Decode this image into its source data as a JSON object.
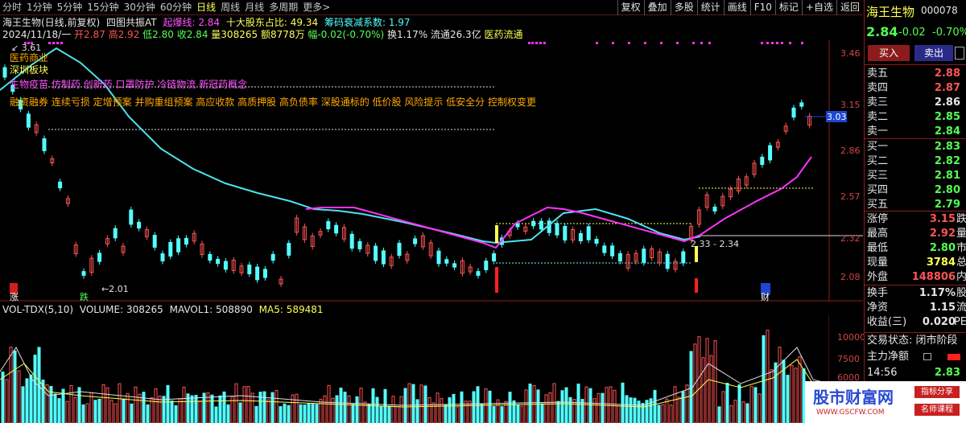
{
  "periods": [
    "分时",
    "1分钟",
    "5分钟",
    "15分钟",
    "30分钟",
    "60分钟",
    "日线",
    "周线",
    "月线",
    "多周期",
    "更多>"
  ],
  "active_period": "日线",
  "toolbar": [
    "复权",
    "叠加",
    "多股",
    "统计",
    "画线",
    "F10",
    "标记",
    "+自选",
    "返回"
  ],
  "header": {
    "title": "海王生物(日线,前复权)",
    "indicator": "四图共振AT",
    "qibao_label": "起爆线:",
    "qibao_value": "2.84",
    "top10_label": "十大股东占比:",
    "top10_value": "49.34",
    "chip_label": "筹码衰减系数:",
    "chip_value": "1.97"
  },
  "quote_line": {
    "date": "2024/11/18/一",
    "open": "开2.87",
    "high": "高2.92",
    "low": "低2.80",
    "close": "收2.84",
    "volume": "量308265",
    "amount": "额8778万",
    "change": "幅-0.02(-0.70%)",
    "turnover": "换1.17%",
    "float": "流通26.3亿",
    "sector": "医药流通"
  },
  "overlay_labels": {
    "line1": "医药商业",
    "line2": "深圳板块",
    "line3": "生物疫苗 仿制药 创新药 口罩防护 冷链物流 新冠药概念",
    "line4": "融资融券 连续亏损 定增预案 并购重组预案 高应收款 高质押股 高负债率 深股通标的 低价股 风险提示 低安全分 控制权变更",
    "price_tag_top": "3.61",
    "price_tag_low": "2.01",
    "range_label": "2.33 - 2.34",
    "zhang": "涨",
    "die": "跌",
    "cai": "财"
  },
  "price_axis": [
    "3.46",
    "3.15",
    "2.86",
    "2.57",
    "2.32",
    "2.08"
  ],
  "current_price_tag": "3.03",
  "volume_header": {
    "name": "VOL-TDX(5,10)",
    "volume": "VOLUME: 308265",
    "mavol1": "MAVOL1: 508890",
    "ma5": "MA5: 589481"
  },
  "volume_axis": [
    "10000",
    "7500",
    "6000"
  ],
  "panel": {
    "stock_name": "海王生物",
    "stock_code": "000078",
    "price": "2.84",
    "change": "-0.02",
    "change_pct": "-0.70%",
    "buy_btn": "买入",
    "sell_btn": "卖出",
    "sells": [
      {
        "label": "卖五",
        "price": "2.88"
      },
      {
        "label": "卖四",
        "price": "2.87"
      },
      {
        "label": "卖三",
        "price": "2.86"
      },
      {
        "label": "卖二",
        "price": "2.85"
      },
      {
        "label": "卖一",
        "price": "2.84"
      }
    ],
    "buys": [
      {
        "label": "买一",
        "price": "2.83"
      },
      {
        "label": "买二",
        "price": "2.82"
      },
      {
        "label": "买三",
        "price": "2.81"
      },
      {
        "label": "买四",
        "price": "2.80"
      },
      {
        "label": "买五",
        "price": "2.79"
      }
    ],
    "stats": [
      {
        "label": "涨停",
        "value": "3.15",
        "suffix": "跌",
        "color": "#ff5454"
      },
      {
        "label": "最高",
        "value": "2.92",
        "suffix": "量",
        "color": "#ff5454"
      },
      {
        "label": "最低",
        "value": "2.80",
        "suffix": "市",
        "color": "#54ff54"
      },
      {
        "label": "现量",
        "value": "3784",
        "suffix": "总",
        "color": "#ffff54"
      },
      {
        "label": "外盘",
        "value": "148806",
        "suffix": "内",
        "color": "#ff5454"
      }
    ],
    "stats2": [
      {
        "label": "换手",
        "value": "1.17%",
        "suffix": "股"
      },
      {
        "label": "净资",
        "value": "1.15",
        "suffix": "流"
      },
      {
        "label": "收益(三)",
        "value": "0.020",
        "suffix": "PE"
      }
    ],
    "trade_status": "交易状态: 闭市阶段",
    "main_flow": "主力净额",
    "tick_time": "14:56",
    "tick_price": "2.83"
  },
  "watermark": {
    "main": "股市财富网",
    "url": "WWW.GSCFW.COM",
    "tag1": "指标分享",
    "tag2": "名师课程"
  },
  "colors": {
    "up": "#ff5454",
    "down": "#54ffff",
    "ma_cyan": "#4ee2ee",
    "ma_magenta": "#ff33ff"
  },
  "chart_data": {
    "type": "candlestick",
    "price_ticks": [
      3.46,
      3.15,
      2.86,
      2.57,
      2.32,
      2.08
    ],
    "current_price": 2.84
  }
}
